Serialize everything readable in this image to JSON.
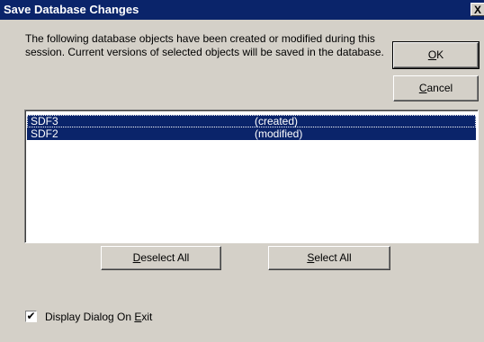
{
  "window": {
    "title": "Save Database Changes",
    "close_glyph": "X"
  },
  "message": "The following database objects have been created or modified during this session. Current versions of selected objects will be saved in the database.",
  "buttons": {
    "ok": {
      "accel": "O",
      "rest": "K"
    },
    "cancel": {
      "accel": "C",
      "rest": "ancel"
    },
    "deselect_all": {
      "accel": "D",
      "rest": "eselect All"
    },
    "select_all": {
      "accel": "S",
      "rest": "elect All"
    }
  },
  "list": {
    "items": [
      {
        "name": "SDF3",
        "status": "(created)",
        "selected": true
      },
      {
        "name": "SDF2",
        "status": "(modified)",
        "selected": true
      }
    ]
  },
  "option": {
    "checked": true,
    "check_glyph": "✔",
    "label_pre": "Display Dialog On ",
    "label_accel": "E",
    "label_post": "xit"
  },
  "colors": {
    "title_bg": "#0a246a",
    "selection_bg": "#0a246a",
    "dialog_bg": "#d4d0c8"
  }
}
